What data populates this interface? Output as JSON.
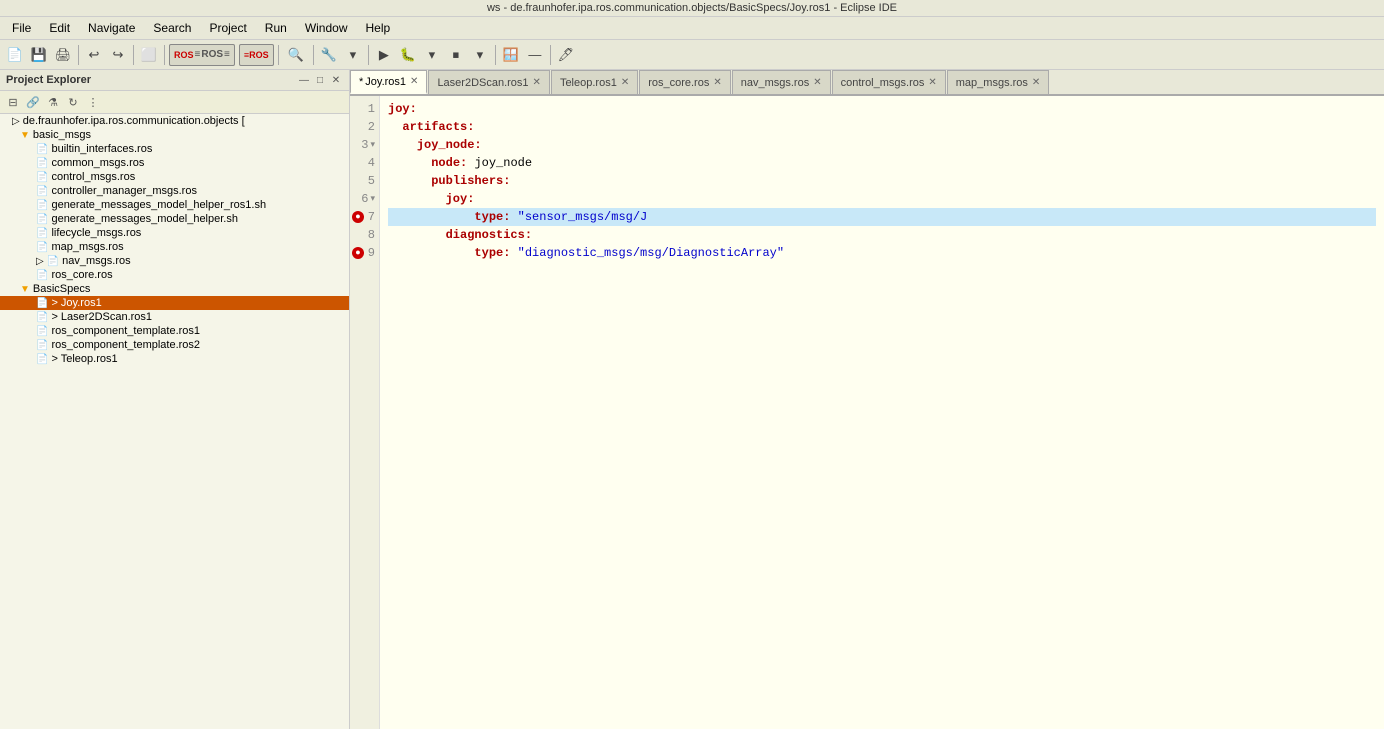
{
  "window": {
    "title": "ws - de.fraunhofer.ipa.ros.communication.objects/BasicSpecs/Joy.ros1 - Eclipse IDE"
  },
  "menu": {
    "items": [
      "File",
      "Edit",
      "Navigate",
      "Search",
      "Project",
      "Run",
      "Window",
      "Help"
    ]
  },
  "toolbar": {
    "groups": [
      {
        "type": "btn",
        "icon": "💾",
        "name": "save"
      },
      {
        "type": "btn",
        "icon": "📋",
        "name": "new"
      },
      {
        "type": "sep"
      },
      {
        "type": "btn",
        "icon": "↩",
        "name": "undo"
      },
      {
        "type": "btn",
        "icon": "↪",
        "name": "redo"
      },
      {
        "type": "sep"
      },
      {
        "type": "btn",
        "icon": "⬜",
        "name": "view"
      },
      {
        "type": "sep"
      }
    ]
  },
  "sidebar": {
    "title": "Project Explorer",
    "items": [
      {
        "id": "root",
        "label": "de.fraunhofer.ipa.ros.communication.objects [",
        "level": 0,
        "icon": "▷",
        "type": "project"
      },
      {
        "id": "basic_msgs",
        "label": "basic_msgs",
        "level": 1,
        "icon": "📁",
        "type": "folder",
        "expanded": true
      },
      {
        "id": "builtin_interfaces",
        "label": "builtin_interfaces.ros",
        "level": 2,
        "icon": "📄",
        "type": "file"
      },
      {
        "id": "common_msgs",
        "label": "common_msgs.ros",
        "level": 2,
        "icon": "📄",
        "type": "file"
      },
      {
        "id": "control_msgs",
        "label": "control_msgs.ros",
        "level": 2,
        "icon": "📄",
        "type": "file"
      },
      {
        "id": "controller_manager_msgs",
        "label": "controller_manager_msgs.ros",
        "level": 2,
        "icon": "📄",
        "type": "file"
      },
      {
        "id": "generate_messages_model_helper_ros1",
        "label": "generate_messages_model_helper_ros1.sh",
        "level": 2,
        "icon": "📄",
        "type": "file"
      },
      {
        "id": "generate_messages_model_helper",
        "label": "generate_messages_model_helper.sh",
        "level": 2,
        "icon": "📄",
        "type": "file"
      },
      {
        "id": "lifecycle_msgs",
        "label": "lifecycle_msgs.ros",
        "level": 2,
        "icon": "📄",
        "type": "file"
      },
      {
        "id": "map_msgs",
        "label": "map_msgs.ros",
        "level": 2,
        "icon": "📄",
        "type": "file"
      },
      {
        "id": "nav_msgs",
        "label": "nav_msgs.ros",
        "level": 2,
        "icon": "📄",
        "type": "file",
        "arrow": "▷"
      },
      {
        "id": "ros_core",
        "label": "ros_core.ros",
        "level": 2,
        "icon": "📄",
        "type": "file"
      },
      {
        "id": "BasicSpecs",
        "label": "BasicSpecs",
        "level": 1,
        "icon": "📁",
        "type": "folder",
        "expanded": true
      },
      {
        "id": "Joy_ros1",
        "label": "> Joy.ros1",
        "level": 2,
        "icon": "📄",
        "type": "file",
        "selected": true
      },
      {
        "id": "Laser2DScan_ros1",
        "label": "> Laser2DScan.ros1",
        "level": 2,
        "icon": "📄",
        "type": "file"
      },
      {
        "id": "ros_component_template_ros1",
        "label": "ros_component_template.ros1",
        "level": 2,
        "icon": "📄",
        "type": "file"
      },
      {
        "id": "ros_component_template_ros2",
        "label": "ros_component_template.ros2",
        "level": 2,
        "icon": "📄",
        "type": "file"
      },
      {
        "id": "Teleop_ros1",
        "label": "> Teleop.ros1",
        "level": 2,
        "icon": "📄",
        "type": "file"
      }
    ]
  },
  "editor": {
    "tabs": [
      {
        "id": "joy_ros1",
        "label": "*Joy.ros1",
        "active": true,
        "modified": true
      },
      {
        "id": "laser_ros1",
        "label": "Laser2DScan.ros1",
        "active": false,
        "modified": false
      },
      {
        "id": "teleop_ros1",
        "label": "Teleop.ros1",
        "active": false,
        "modified": false
      },
      {
        "id": "ros_core",
        "label": "ros_core.ros",
        "active": false,
        "modified": false
      },
      {
        "id": "nav_msgs",
        "label": "nav_msgs.ros",
        "active": false,
        "modified": false
      },
      {
        "id": "control_msgs",
        "label": "control_msgs.ros",
        "active": false,
        "modified": false
      },
      {
        "id": "map_msgs",
        "label": "map_msgs.ros",
        "active": false,
        "modified": false
      }
    ],
    "lines": [
      {
        "num": 1,
        "text": "joy:",
        "indent": 0,
        "error": null,
        "fold": null
      },
      {
        "num": 2,
        "text": "  artifacts:",
        "indent": 0,
        "error": null,
        "fold": null
      },
      {
        "num": 3,
        "text": "    joy_node:",
        "indent": 0,
        "error": null,
        "fold": "▾"
      },
      {
        "num": 4,
        "text": "      node: joy_node",
        "indent": 0,
        "error": null,
        "fold": null
      },
      {
        "num": 5,
        "text": "      publishers:",
        "indent": 0,
        "error": null,
        "fold": null
      },
      {
        "num": 6,
        "text": "        joy:",
        "indent": 0,
        "error": null,
        "fold": "▾"
      },
      {
        "num": 7,
        "text": "            type: \"sensor_msgs/msg/J",
        "indent": 0,
        "error": "error",
        "fold": null,
        "highlighted": true
      },
      {
        "num": 8,
        "text": "        diagnostics:",
        "indent": 0,
        "error": null,
        "fold": null
      },
      {
        "num": 9,
        "text": "            type: \"diagnostic_msgs/msg/DiagnosticArray\"",
        "indent": 0,
        "error": "error",
        "fold": null
      }
    ]
  },
  "colors": {
    "accent": "#cc5500",
    "background": "#fffff0",
    "sidebar_bg": "#f5f5e8",
    "toolbar_bg": "#e8e8d8",
    "error_red": "#cc0000",
    "highlight_blue": "#c8e8f8"
  }
}
